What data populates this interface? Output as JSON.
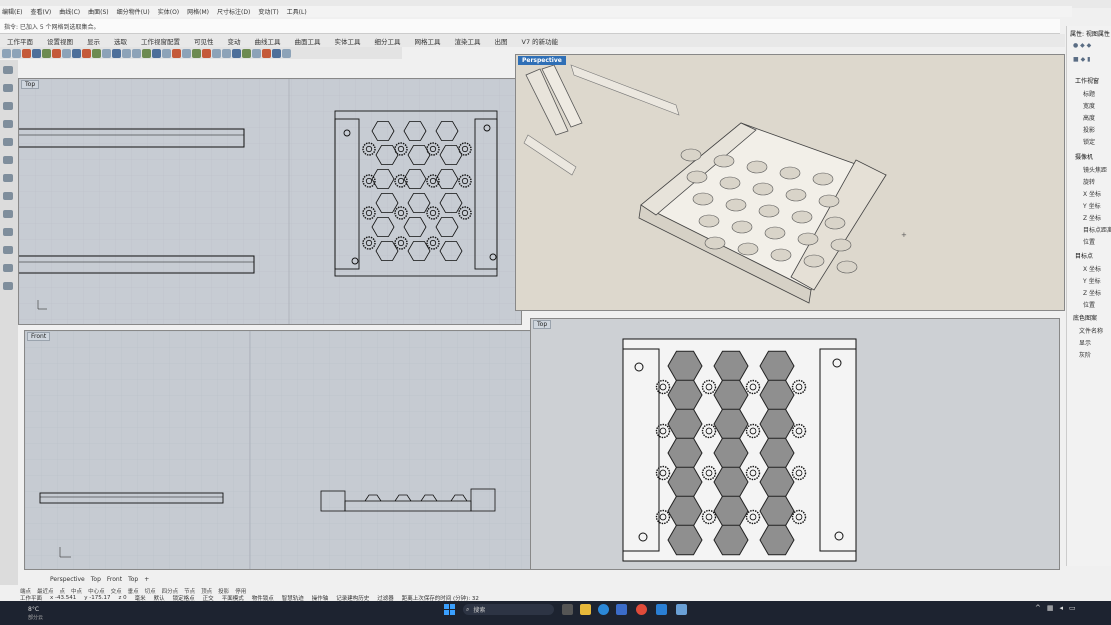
{
  "menu": {
    "items": [
      "编辑(E)",
      "查看(V)",
      "曲线(C)",
      "曲面(S)",
      "细分物件(U)",
      "实体(O)",
      "网格(M)",
      "尺寸标注(D)",
      "变动(T)",
      "工具(L)"
    ]
  },
  "command_prompt": "指令: 已加入 5 个网格到选取集合。",
  "ribbon_tabs": [
    "工作平面",
    "设置视图",
    "显示",
    "选取",
    "工作视窗配置",
    "可见性",
    "变动",
    "曲线工具",
    "曲面工具",
    "实体工具",
    "细分工具",
    "网格工具",
    "渲染工具",
    "出图",
    "V7 的新功能"
  ],
  "viewports": {
    "top_left": {
      "label": "Top"
    },
    "perspective": {
      "label": "Perspective"
    },
    "front": {
      "label": "Front"
    },
    "top_right": {
      "label": "Top"
    }
  },
  "right_panel": {
    "tab_label": "属性: 视图属性",
    "section_view": "工作视窗",
    "view_fields": [
      "标题",
      "宽度",
      "高度",
      "投影",
      "锁定"
    ],
    "section_camera": "摄像机",
    "camera_fields": [
      "镜头焦距",
      "旋转",
      "X 坐标",
      "Y 坐标",
      "Z 坐标",
      "目标点距离",
      "位置"
    ],
    "section_target": "目标点",
    "target_fields": [
      "X 坐标",
      "Y 坐标",
      "Z 坐标",
      "位置"
    ],
    "section_wallpaper": "底色图案",
    "wallpaper_fields": [
      "文件名称",
      "显示",
      "灰阶"
    ]
  },
  "view_tabs": [
    "Perspective",
    "Top",
    "Front",
    "Top",
    "+"
  ],
  "osnaps": [
    "端点",
    "最近点",
    "点",
    "中点",
    "中心点",
    "交点",
    "垂点",
    "切点",
    "四分点",
    "节点",
    "顶点",
    "投影",
    "停用"
  ],
  "status": {
    "cplane": "工作平面",
    "x": "x -43.541",
    "y": "y -175.17",
    "z": "z 0",
    "units": "毫米",
    "layer": "默认",
    "items": [
      "锁定格点",
      "正交",
      "平面模式",
      "物件锁点",
      "智慧轨迹",
      "操作轴",
      "记录建构历史",
      "过滤器",
      "距离上次保存的时间 (分钟): 32"
    ]
  },
  "taskbar": {
    "search_placeholder": "搜索",
    "weather": "8°C",
    "weather_sub": "部分云"
  }
}
